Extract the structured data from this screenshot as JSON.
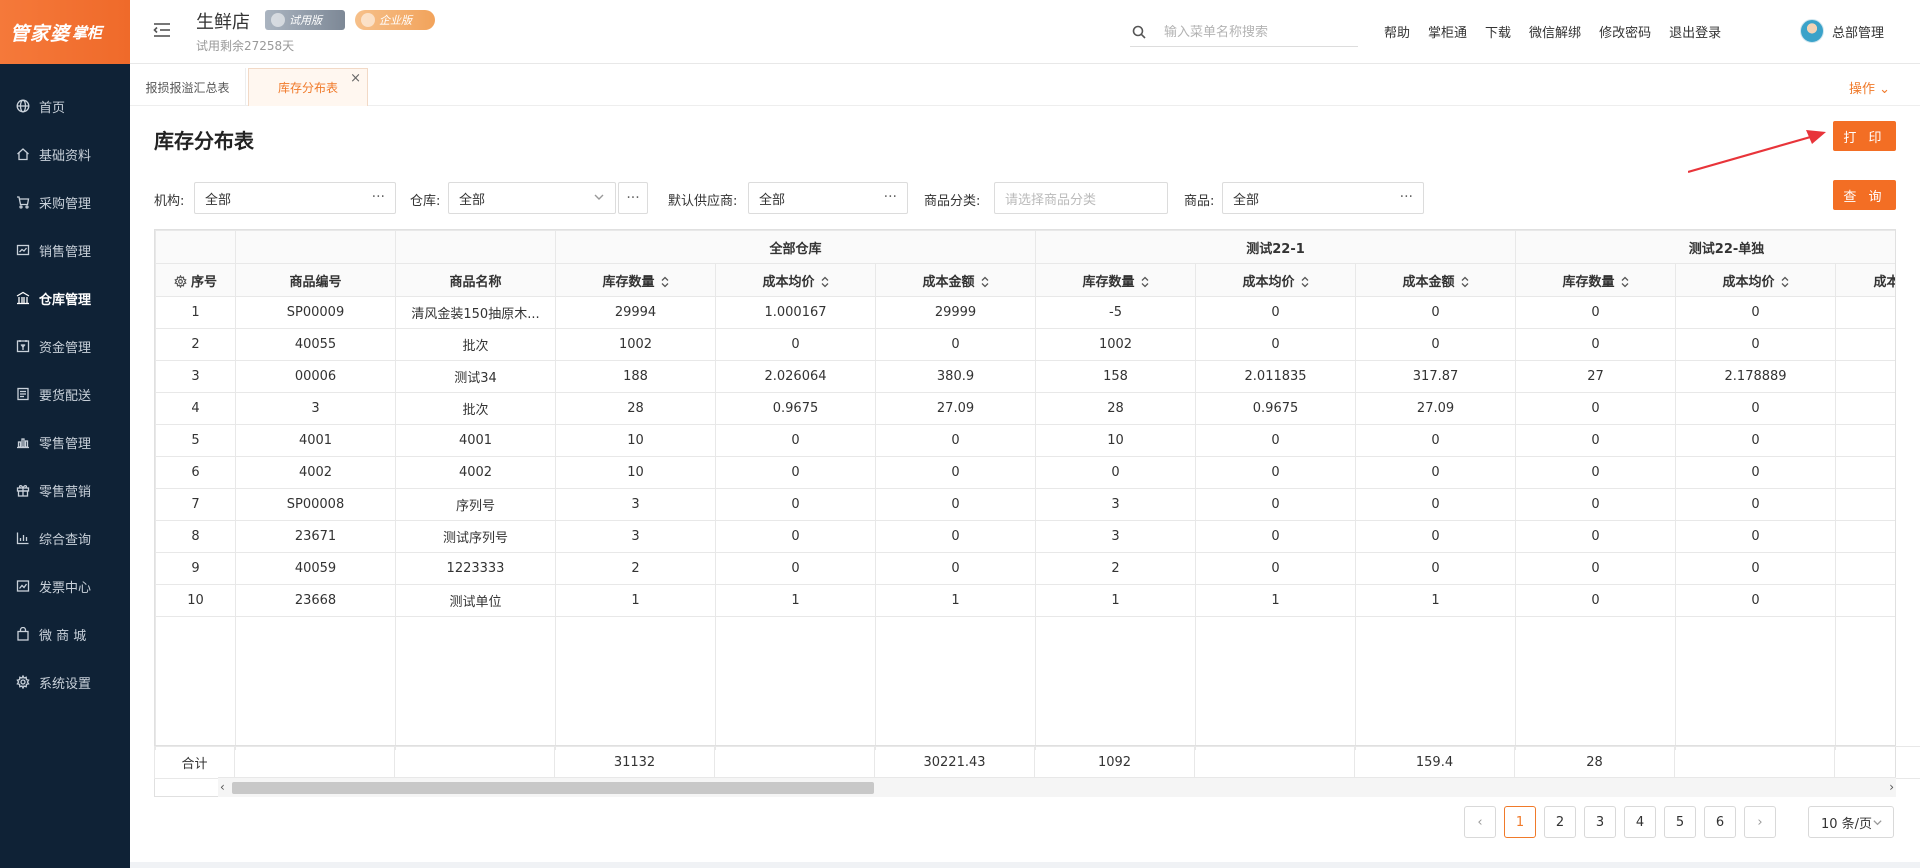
{
  "app": {
    "logo_main": "管家婆",
    "logo_sub": "掌柜"
  },
  "sidebar": {
    "items": [
      {
        "label": "首页",
        "icon": "globe-icon"
      },
      {
        "label": "基础资料",
        "icon": "home-icon"
      },
      {
        "label": "采购管理",
        "icon": "cart-icon"
      },
      {
        "label": "销售管理",
        "icon": "sales-icon"
      },
      {
        "label": "仓库管理",
        "icon": "warehouse-icon",
        "active": true
      },
      {
        "label": "资金管理",
        "icon": "fund-icon"
      },
      {
        "label": "要货配送",
        "icon": "delivery-icon"
      },
      {
        "label": "零售管理",
        "icon": "retail-icon"
      },
      {
        "label": "零售营销",
        "icon": "gift-icon"
      },
      {
        "label": "综合查询",
        "icon": "chart-icon"
      },
      {
        "label": "发票中心",
        "icon": "invoice-icon"
      },
      {
        "label": "微 商 城",
        "icon": "shop-icon"
      },
      {
        "label": "系统设置",
        "icon": "gear-icon"
      }
    ]
  },
  "header": {
    "store_name": "生鲜店",
    "trial_badge": "试用版",
    "enterprise_badge": "企业版",
    "trial_remaining": "试用剩余27258天",
    "search_placeholder": "输入菜单名称搜索",
    "links": [
      "帮助",
      "掌柜通",
      "下载",
      "微信解绑",
      "修改密码",
      "退出登录"
    ],
    "user_name": "总部管理"
  },
  "tabs": {
    "items": [
      "报损报溢汇总表",
      "库存分布表"
    ],
    "active": 1,
    "operations": "操作"
  },
  "page": {
    "title": "库存分布表",
    "print_button": "打 印",
    "query_button": "查 询"
  },
  "filters": {
    "org_label": "机构:",
    "org_value": "全部",
    "warehouse_label": "仓库:",
    "warehouse_value": "全部",
    "supplier_label": "默认供应商:",
    "supplier_value": "全部",
    "category_label": "商品分类:",
    "category_placeholder": "请选择商品分类",
    "product_label": "商品:",
    "product_value": "全部"
  },
  "table": {
    "group_headers": [
      "全部仓库",
      "测试22-1",
      "测试22-单独"
    ],
    "columns": [
      "序号",
      "商品编号",
      "商品名称",
      "库存数量",
      "成本均价",
      "成本金额",
      "库存数量",
      "成本均价",
      "成本金额",
      "库存数量",
      "成本均价",
      "成本"
    ],
    "rows": [
      [
        "1",
        "SP00009",
        "清风金装150抽原木...",
        "29994",
        "1.000167",
        "29999",
        "-5",
        "0",
        "0",
        "0",
        "0",
        ""
      ],
      [
        "2",
        "40055",
        "批次",
        "1002",
        "0",
        "0",
        "1002",
        "0",
        "0",
        "0",
        "0",
        ""
      ],
      [
        "3",
        "00006",
        "测试34",
        "188",
        "2.026064",
        "380.9",
        "158",
        "2.011835",
        "317.87",
        "27",
        "2.178889",
        ""
      ],
      [
        "4",
        "3",
        "批次",
        "28",
        "0.9675",
        "27.09",
        "28",
        "0.9675",
        "27.09",
        "0",
        "0",
        ""
      ],
      [
        "5",
        "4001",
        "4001",
        "10",
        "0",
        "0",
        "10",
        "0",
        "0",
        "0",
        "0",
        ""
      ],
      [
        "6",
        "4002",
        "4002",
        "10",
        "0",
        "0",
        "0",
        "0",
        "0",
        "0",
        "0",
        ""
      ],
      [
        "7",
        "SP00008",
        "序列号",
        "3",
        "0",
        "0",
        "3",
        "0",
        "0",
        "0",
        "0",
        ""
      ],
      [
        "8",
        "23671",
        "测试序列号",
        "3",
        "0",
        "0",
        "3",
        "0",
        "0",
        "0",
        "0",
        ""
      ],
      [
        "9",
        "40059",
        "1223333",
        "2",
        "0",
        "0",
        "2",
        "0",
        "0",
        "0",
        "0",
        ""
      ],
      [
        "10",
        "23668",
        "测试单位",
        "1",
        "1",
        "1",
        "1",
        "1",
        "1",
        "0",
        "0",
        ""
      ]
    ],
    "totals": [
      "合计",
      "",
      "",
      "31132",
      "",
      "30221.43",
      "1092",
      "",
      "159.4",
      "28",
      "",
      ""
    ]
  },
  "pagination": {
    "pages": [
      "1",
      "2",
      "3",
      "4",
      "5",
      "6"
    ],
    "current": "1",
    "page_size": "10 条/页"
  },
  "colors": {
    "accent": "#f36e24",
    "sidebar_bg": "#0f2236"
  }
}
